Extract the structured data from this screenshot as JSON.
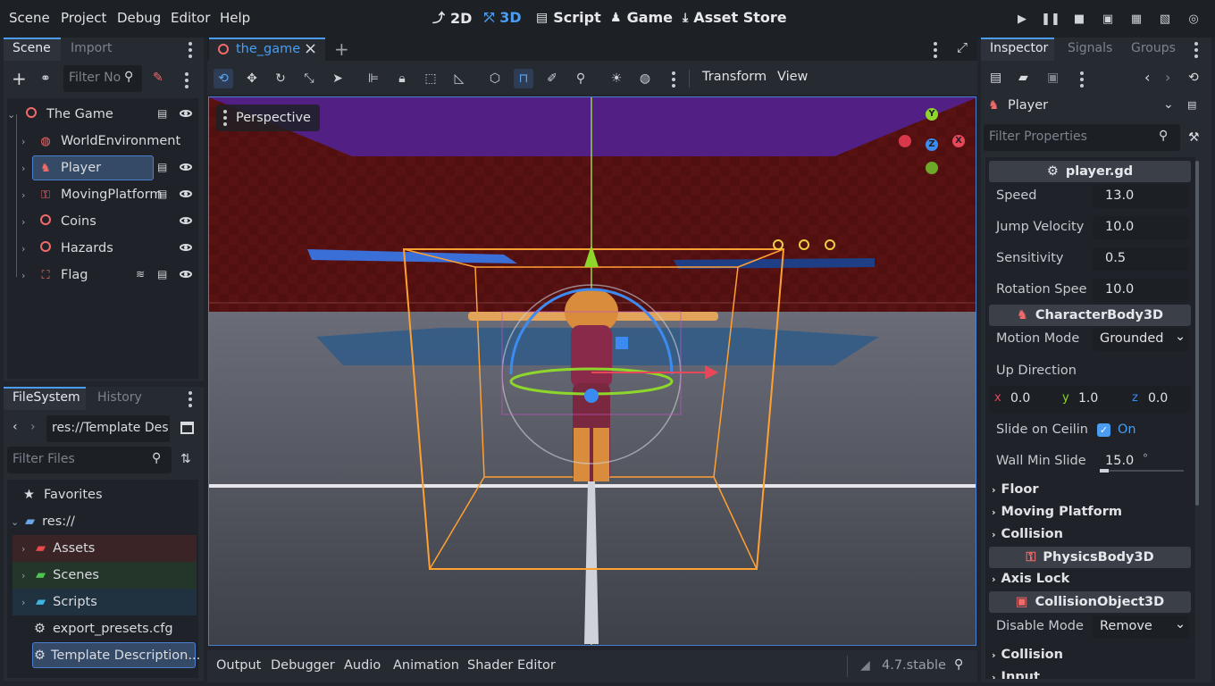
{
  "menu": [
    "Scene",
    "Project",
    "Debug",
    "Editor",
    "Help"
  ],
  "workspaces": [
    {
      "label": "2D",
      "icon": "2d-icon",
      "active": false
    },
    {
      "label": "3D",
      "icon": "3d-icon",
      "active": true
    },
    {
      "label": "Script",
      "icon": "script-icon",
      "active": false
    },
    {
      "label": "Game",
      "icon": "game-icon",
      "active": false
    },
    {
      "label": "Asset Store",
      "icon": "asset-store-icon",
      "active": false
    }
  ],
  "scene_dock": {
    "tabs": [
      "Scene",
      "Import"
    ],
    "filter_placeholder": "Filter No",
    "nodes": [
      {
        "label": "The Game",
        "icon": "node3d-icon"
      },
      {
        "label": "WorldEnvironment",
        "icon": "world-environment-icon"
      },
      {
        "label": "Player",
        "icon": "character-body-icon"
      },
      {
        "label": "MovingPlatform",
        "icon": "animatable-body-icon"
      },
      {
        "label": "Coins",
        "icon": "node3d-icon"
      },
      {
        "label": "Hazards",
        "icon": "node3d-icon"
      },
      {
        "label": "Flag",
        "icon": "area3d-icon"
      }
    ]
  },
  "filesystem": {
    "tabs": [
      "FileSystem",
      "History"
    ],
    "path": "res://Template Des",
    "filter_placeholder": "Filter Files",
    "items": [
      {
        "label": "Favorites",
        "icon": "star-icon"
      },
      {
        "label": "res://",
        "icon": "folder-icon"
      },
      {
        "label": "Assets",
        "icon": "folder-icon",
        "color": "#e84a4a"
      },
      {
        "label": "Scenes",
        "icon": "folder-icon",
        "color": "#4ec64e"
      },
      {
        "label": "Scripts",
        "icon": "folder-icon",
        "color": "#3cb6e0"
      },
      {
        "label": "export_presets.cfg",
        "icon": "text-file-icon"
      },
      {
        "label": "Template Description...",
        "icon": "text-file-icon"
      }
    ]
  },
  "editor": {
    "scene_tab": "the_game",
    "toolbar_menus": [
      "Transform",
      "View"
    ],
    "viewport_label": "Perspective"
  },
  "bottom": {
    "tabs": [
      "Output",
      "Debugger",
      "Audio",
      "Animation",
      "Shader Editor"
    ],
    "version": "4.7.stable"
  },
  "inspector": {
    "tabs": [
      "Inspector",
      "Signals",
      "Groups"
    ],
    "node_name": "Player",
    "filter_placeholder": "Filter Properties",
    "script_name": "player.gd",
    "script_props": [
      {
        "label": "Speed",
        "value": "13.0"
      },
      {
        "label": "Jump Velocity",
        "value": "10.0"
      },
      {
        "label": "Sensitivity",
        "value": "0.5"
      },
      {
        "label": "Rotation Spee",
        "value": "10.0"
      }
    ],
    "class_character": "CharacterBody3D",
    "motion_mode_label": "Motion Mode",
    "motion_mode_value": "Grounded",
    "up_direction_label": "Up Direction",
    "up_direction": {
      "x": "0.0",
      "y": "1.0",
      "z": "0.0"
    },
    "slide_ceiling_label": "Slide on Ceilin",
    "slide_ceiling_value": "On",
    "wall_min_slide_label": "Wall Min Slide",
    "wall_min_slide_value": "15.0",
    "wall_min_slide_unit": "°",
    "groups_a": [
      "Floor",
      "Moving Platform",
      "Collision"
    ],
    "class_physics": "PhysicsBody3D",
    "axis_lock": "Axis Lock",
    "class_collision": "CollisionObject3D",
    "disable_mode_label": "Disable Mode",
    "disable_mode_value": "Remove",
    "groups_b": [
      "Collision",
      "Input"
    ]
  },
  "colors": {
    "accent": "#4a9df0",
    "node_red": "#f26b6b",
    "selection_orange": "#ffa033"
  }
}
